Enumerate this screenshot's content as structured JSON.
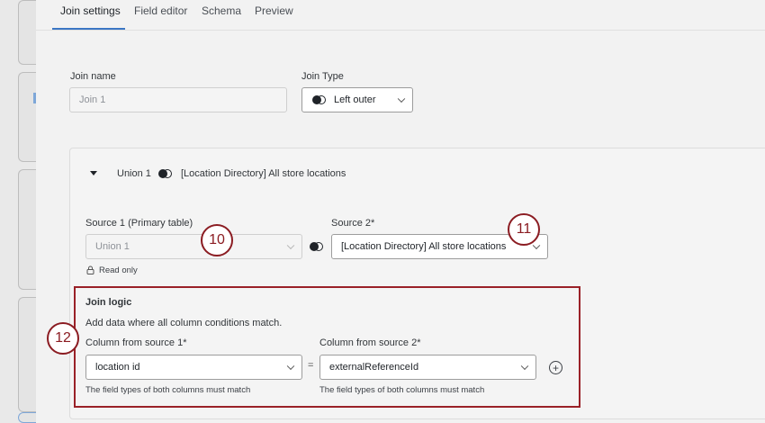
{
  "tabs": [
    {
      "label": "Join settings",
      "active": true
    },
    {
      "label": "Field editor",
      "active": false
    },
    {
      "label": "Schema",
      "active": false
    },
    {
      "label": "Preview",
      "active": false
    }
  ],
  "join_name": {
    "label": "Join name",
    "value": "Join 1"
  },
  "join_type": {
    "label": "Join Type",
    "value": "Left outer",
    "icon": "left-outer-join-icon"
  },
  "union_header": {
    "name": "Union 1",
    "source": "[Location Directory] All store locations",
    "icon": "join-icon"
  },
  "source1": {
    "label": "Source 1 (Primary table)",
    "value": "Union 1",
    "read_only": "Read only"
  },
  "source2": {
    "label": "Source 2*",
    "value": "[Location Directory] All store locations"
  },
  "join_logic": {
    "title": "Join logic",
    "description": "Add data where all column conditions match.",
    "col1": {
      "label": "Column from source 1*",
      "value": "location id",
      "hint": "The field types of both columns must match"
    },
    "equals": "=",
    "col2": {
      "label": "Column from source 2*",
      "value": "externalReferenceId",
      "hint": "The field types of both columns must match"
    },
    "add": "+"
  },
  "callouts": {
    "c10": "10",
    "c11": "11",
    "c12": "12"
  },
  "colors": {
    "accent": "#3b76c4",
    "callout": "#8b1c22",
    "highlight_border": "#9a2128"
  }
}
